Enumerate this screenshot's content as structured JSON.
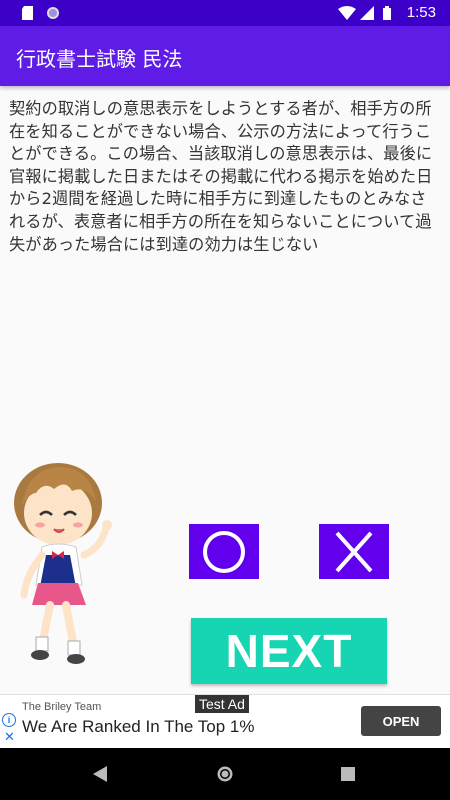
{
  "status_bar": {
    "time": "1:53"
  },
  "app_bar": {
    "title": "行政書士試験 民法"
  },
  "question": {
    "text": "契約の取消しの意思表示をしようとする者が、相手方の所在を知ることができない場合、公示の方法によって行うことができる。この場合、当該取消しの意思表示は、最後に官報に掲載した日またはその掲載に代わる掲示を始めた日から2週間を経過した時に相手方に到達したものとみなされるが、表意者に相手方の所在を知らないことについて過失があった場合には到達の効力は生じない"
  },
  "answers": {
    "correct_icon": "circle-icon",
    "wrong_icon": "cross-icon"
  },
  "next_button": {
    "label": "NEXT"
  },
  "ad": {
    "badge": "Test Ad",
    "advertiser": "The Briley Team",
    "headline": "We Are Ranked In The Top 1%",
    "cta": "OPEN",
    "info": "i",
    "close": "✕"
  },
  "colors": {
    "primary": "#5e1ce6",
    "status": "#3d00c8",
    "button": "#6200ee",
    "next": "#17d4b3"
  }
}
